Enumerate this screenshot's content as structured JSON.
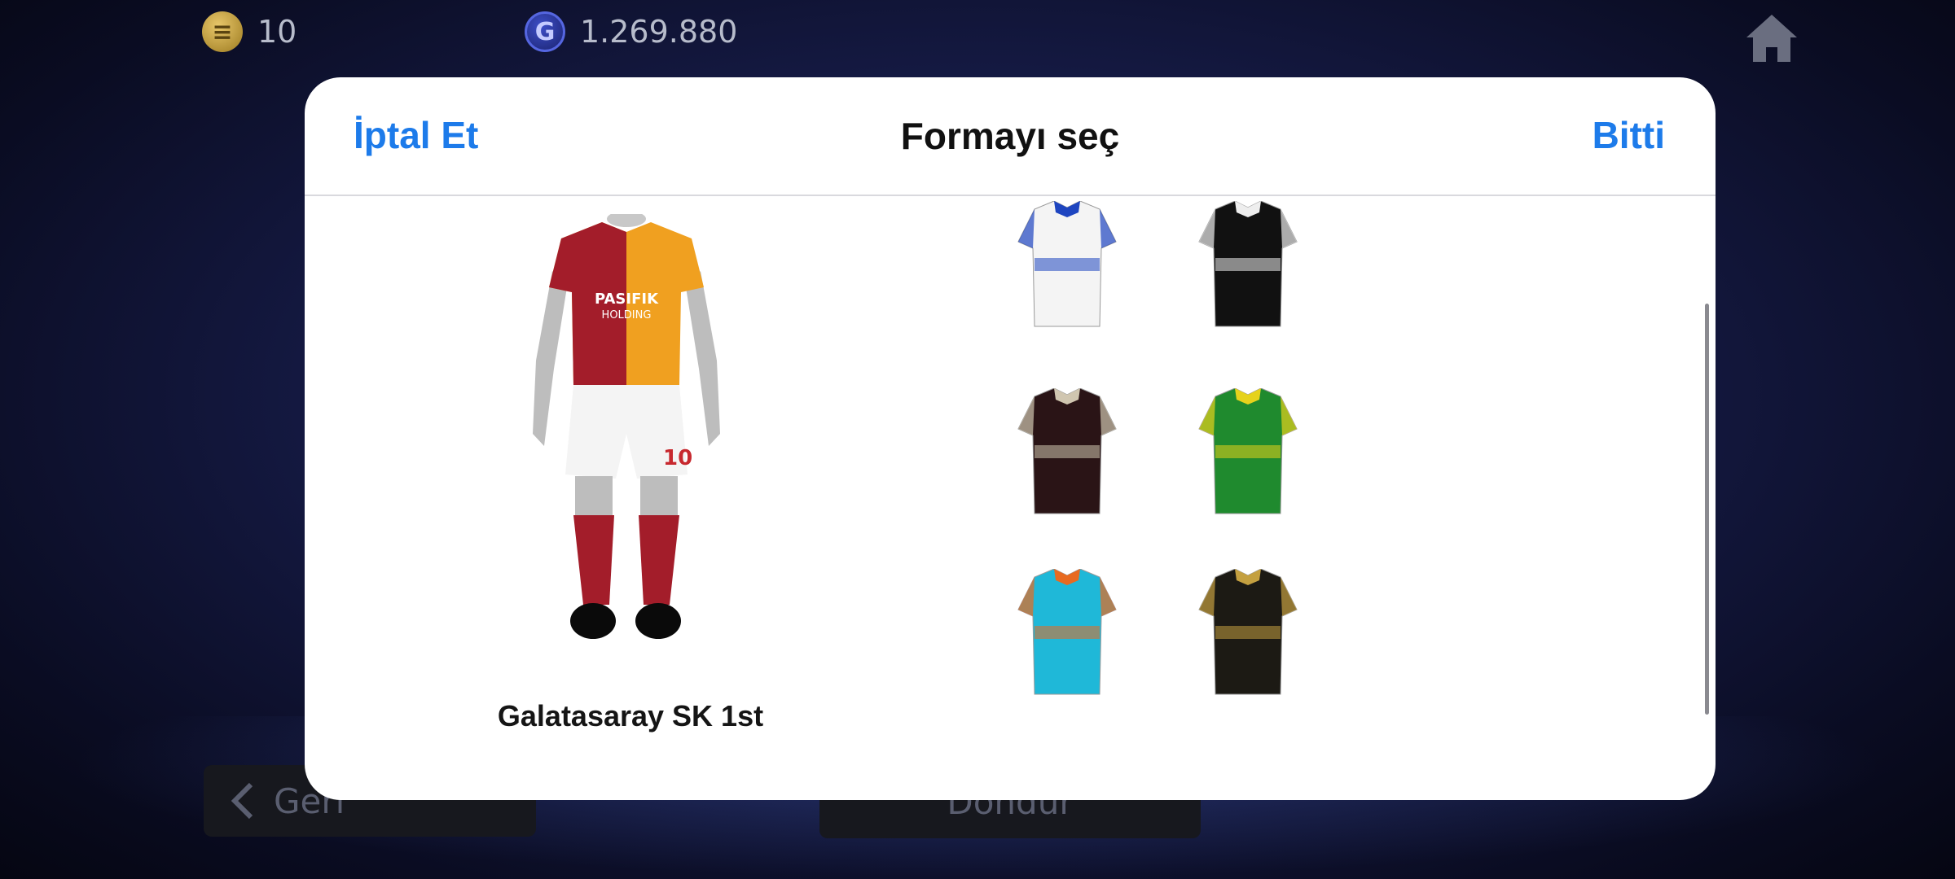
{
  "hud": {
    "coins": "10",
    "gp": "1.269.880",
    "coin_symbol": "≡",
    "gp_symbol": "G"
  },
  "background": {
    "back_label": "Geri",
    "freeze_label": "Dondur"
  },
  "modal": {
    "cancel_label": "İptal Et",
    "title": "Formayı seç",
    "done_label": "Bitti",
    "selected_kit_name": "Galatasaray SK 1st"
  },
  "kits": [
    {
      "name": "galatasaray-home",
      "colors": [
        "#f0a020",
        "#a31d2a"
      ],
      "selected": true
    },
    {
      "name": "galatasaray-away",
      "colors": [
        "#f2f2f2",
        "#b02a30"
      ]
    },
    {
      "name": "white-blue-kit",
      "colors": [
        "#f4f4f4",
        "#1e45c0"
      ]
    },
    {
      "name": "black-white-kit",
      "colors": [
        "#111111",
        "#eeeeee"
      ]
    },
    {
      "name": "white-red-kit",
      "colors": [
        "#f5f5f5",
        "#d63a3a"
      ]
    },
    {
      "name": "white-pattern-kit",
      "colors": [
        "#f3f3f3",
        "#3050c8"
      ]
    },
    {
      "name": "dark-stripe-kit",
      "colors": [
        "#2a1416",
        "#d0c6b0"
      ]
    },
    {
      "name": "green-yellow-kit",
      "colors": [
        "#1f8a2e",
        "#e6d21c"
      ]
    },
    {
      "name": "blue-yellow-kit",
      "colors": [
        "#1b2fbf",
        "#e0d22a"
      ]
    },
    {
      "name": "black-red-kit",
      "colors": [
        "#1c1c1c",
        "#c8283a"
      ]
    },
    {
      "name": "cyan-orange-kit",
      "colors": [
        "#1fb8d8",
        "#e86a20"
      ]
    },
    {
      "name": "black-gold-kit",
      "colors": [
        "#1c1a14",
        "#c4a040"
      ]
    },
    {
      "name": "black-white-stripe-kit",
      "colors": [
        "#181818",
        "#f0f0f0"
      ]
    },
    {
      "name": "red-white-pattern-kit",
      "colors": [
        "#d83040",
        "#f2f2f2"
      ]
    }
  ]
}
